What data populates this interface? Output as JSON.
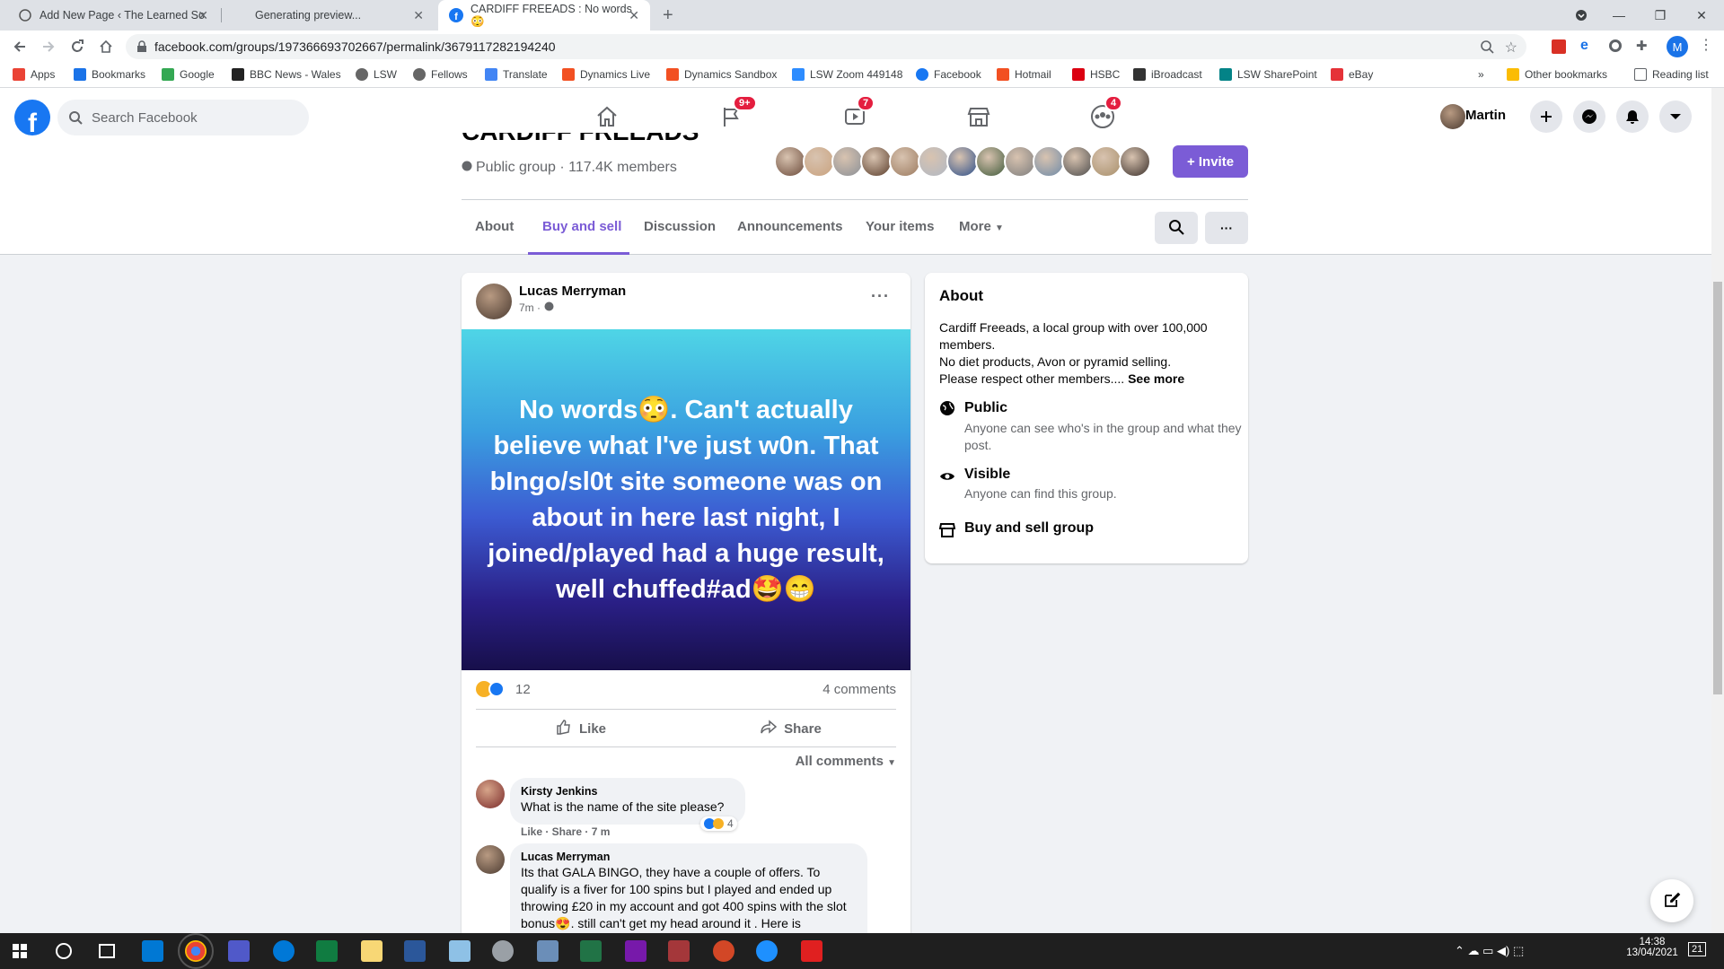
{
  "browser": {
    "tabs": [
      {
        "title": "Add New Page ‹ The Learned So"
      },
      {
        "title": "Generating preview..."
      },
      {
        "title": "CARDIFF FREEADS : No words😳"
      }
    ],
    "new_tab": "+",
    "url": "facebook.com/groups/197366693702667/permalink/3679117282194240",
    "bookmarks": [
      "Apps",
      "Bookmarks",
      "Google",
      "BBC News - Wales",
      "LSW",
      "Fellows",
      "Translate",
      "Dynamics Live",
      "Dynamics Sandbox",
      "LSW Zoom 449148",
      "Facebook",
      "Hotmail",
      "HSBC",
      "iBroadcast",
      "LSW SharePoint",
      "eBay"
    ],
    "bookmarks_more": "»",
    "other_bookmarks": "Other bookmarks",
    "reading_list": "Reading list",
    "profile_initial": "M"
  },
  "fb": {
    "search_placeholder": "Search Facebook",
    "badges": {
      "pages": "9+",
      "watch": "7",
      "groups": "4"
    },
    "user_name": "Martin"
  },
  "group": {
    "name": "CARDIFF FREEADS",
    "meta": "Public group · 117.4K members",
    "invite": "+ Invite",
    "tabs": [
      "About",
      "Buy and sell",
      "Discussion",
      "Announcements",
      "Your items",
      "More"
    ],
    "active_tab": "Buy and sell",
    "member_count_avatars": 13
  },
  "post": {
    "author": "Lucas Merryman",
    "time": "7m ·",
    "text": "No words😳. Can't actually believe what I've just w0n. That bIngo/sl0t site someone was on about in here last night, I joined/played had a huge result, well chuffed#ad🤩😁",
    "reaction_count": "12",
    "comments_count": "4 comments",
    "like": "Like",
    "share": "Share",
    "comments_filter": "All comments",
    "comments": [
      {
        "author": "Kirsty Jenkins",
        "text": "What is the name of the site please?",
        "actions": "Like · Share · 7 m",
        "reactions": "4"
      },
      {
        "author": "Lucas Merryman",
        "text": "Its that GALA BINGO, they have a couple of offers. To qualify is a fiver for 100 spins but I played and ended up throwing £20 in my account and got 400 spins with the slot bonus😍. still can't get my head around it . Here is"
      }
    ]
  },
  "about": {
    "heading": "About",
    "description": "Cardiff Freeads, a local group with over 100,000 members.\nNo diet products, Avon or pyramid selling.\nPlease respect other members....",
    "see_more": "See more",
    "items": [
      {
        "title": "Public",
        "desc": "Anyone can see who's in the group and what they post."
      },
      {
        "title": "Visible",
        "desc": "Anyone can find this group."
      },
      {
        "title": "Buy and sell group",
        "desc": ""
      }
    ]
  },
  "taskbar": {
    "time": "14:38",
    "date": "13/04/2021",
    "notifications": "21"
  },
  "colors": {
    "fb_blue": "#1877f2",
    "accent_purple": "#7b5cd6",
    "badge_red": "#e41e3f"
  }
}
